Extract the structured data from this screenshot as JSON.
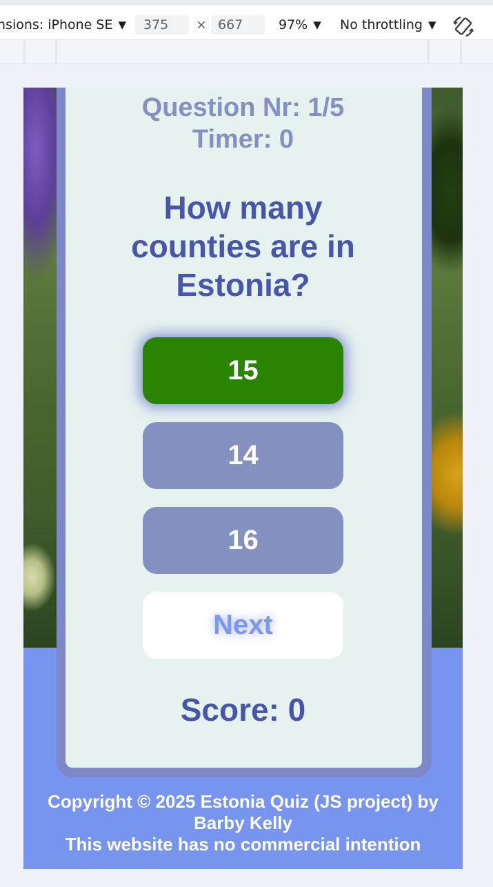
{
  "devtools": {
    "device_label": "nsions: iPhone SE",
    "width_value": "375",
    "times_sign": "×",
    "height_value": "667",
    "zoom_label": "97%",
    "throttle_label": "No throttling"
  },
  "quiz": {
    "question_counter": "Question Nr: 1/5",
    "timer": "Timer: 0",
    "question": "How many counties are in Estonia?",
    "answers": [
      {
        "label": "15",
        "state": "correct"
      },
      {
        "label": "14",
        "state": "default"
      },
      {
        "label": "16",
        "state": "default"
      }
    ],
    "next_label": "Next",
    "score": "Score: 0"
  },
  "footer": {
    "line1": "Copyright © 2025 Estonia Quiz (JS project) by",
    "line2": "Barby Kelly",
    "line3": "This website has no commercial intention"
  },
  "colors": {
    "correct_answer": "#288401",
    "answer_default": "#8490bf",
    "heading_blue": "#4756a8",
    "footer_blue": "#7794ee",
    "card_bg": "#e6f2f0"
  }
}
